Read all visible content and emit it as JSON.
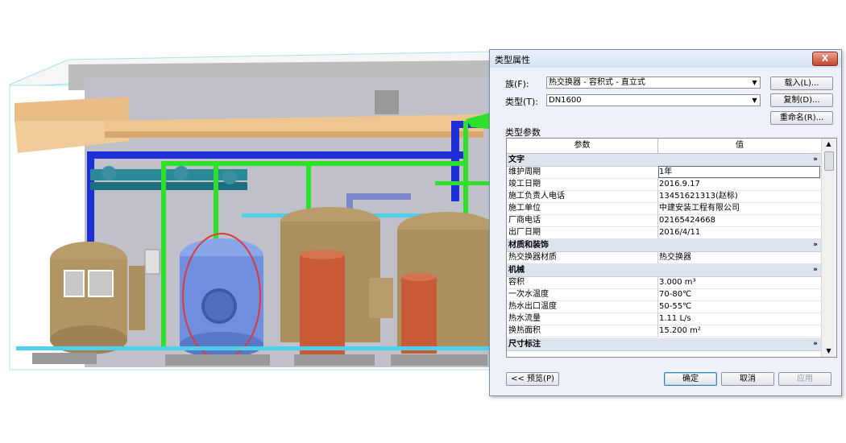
{
  "dialog": {
    "title": "类型属性",
    "close_label": "X",
    "family_label": "族(F):",
    "family_value": "热交换器 - 容积式 - 直立式",
    "type_label": "类型(T):",
    "type_value": "DN1600",
    "load_button": "载入(L)...",
    "duplicate_button": "复制(D)...",
    "rename_button": "重命名(R)...",
    "section_label": "类型参数",
    "col_param": "参数",
    "col_value": "值",
    "groups": {
      "text": "文字",
      "material": "材质和装饰",
      "mechanical": "机械",
      "dimensions": "尺寸标注"
    },
    "rows": [
      {
        "param": "维护周期",
        "value": "1年"
      },
      {
        "param": "竣工日期",
        "value": "2016.9.17"
      },
      {
        "param": "施工负责人电话",
        "value": "13451621313(赵标)"
      },
      {
        "param": "施工单位",
        "value": "中建安装工程有限公司"
      },
      {
        "param": "厂商电话",
        "value": "02165424668"
      },
      {
        "param": "出厂日期",
        "value": "2016/4/11"
      },
      {
        "param": "热交换器材质",
        "value": "热交换器"
      },
      {
        "param": "容积",
        "value": "3.000 m³"
      },
      {
        "param": "一次水温度",
        "value": "70-80℃"
      },
      {
        "param": "热水出口温度",
        "value": "50-55℃"
      },
      {
        "param": "热水流量",
        "value": "1.11 L/s"
      },
      {
        "param": "换热面积",
        "value": "15.200 m²"
      }
    ],
    "preview_button": "<< 预览(P)",
    "ok_button": "确定",
    "cancel_button": "取消",
    "apply_button": "应用",
    "collapse_glyph": "»",
    "icons": {
      "scroll_up": "triangle-up-icon",
      "scroll_down": "triangle-down-icon"
    }
  },
  "colors": {
    "pipe_blue": "#1f2fd6",
    "pipe_green": "#2ee02a",
    "tank_tan": "#b99c6b",
    "tank_red": "#c85a35",
    "highlight_blue": "#6f8fe0",
    "highlight_ring": "#e03a36"
  }
}
